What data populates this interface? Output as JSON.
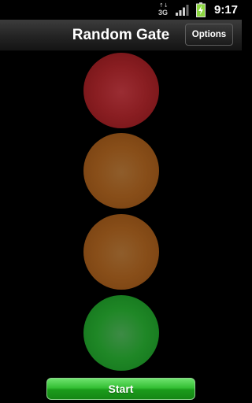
{
  "status_bar": {
    "network_type": "3G",
    "network_arrows": "↑↓",
    "signal_icon": "signal-strength-icon",
    "battery_icon": "battery-charging-icon",
    "time": "9:17"
  },
  "title_bar": {
    "title": "Random Gate",
    "options_label": "Options"
  },
  "lights": [
    {
      "name": "red",
      "color": "#8a1e22"
    },
    {
      "name": "amber",
      "color": "#884e19"
    },
    {
      "name": "amber",
      "color": "#884e19"
    },
    {
      "name": "green",
      "color": "#1f8726"
    }
  ],
  "controls": {
    "start_label": "Start",
    "start_color": "#34bf34"
  }
}
